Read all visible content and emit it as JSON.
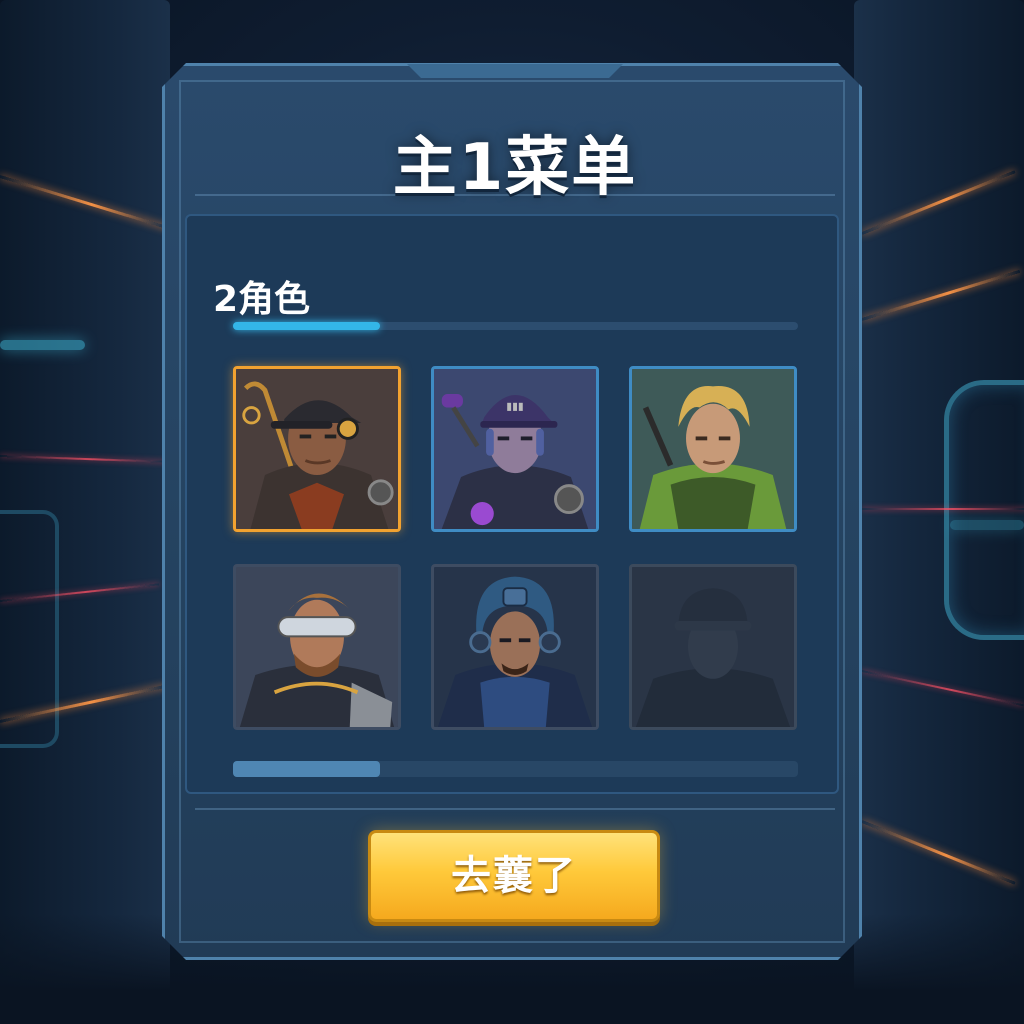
{
  "panel": {
    "title": "主1菜单",
    "section_title": "2角色",
    "section_progress": 0.26,
    "scroll_position": 0.26,
    "confirm_label": "去蘘了"
  },
  "characters": [
    {
      "id": "char-1",
      "state": "selected",
      "portrait": "mechanic-cap-headset"
    },
    {
      "id": "char-2",
      "state": "available",
      "portrait": "purple-cap-cyborg"
    },
    {
      "id": "char-3",
      "state": "available",
      "portrait": "blond-green-armor"
    },
    {
      "id": "char-4",
      "state": "available",
      "portrait": "goggles-bearded"
    },
    {
      "id": "char-5",
      "state": "available",
      "portrait": "blue-helmet-soldier"
    },
    {
      "id": "char-6",
      "state": "locked",
      "portrait": "shadow-helmet"
    }
  ],
  "colors": {
    "accent_blue": "#33b6e8",
    "selected_orange": "#f2a230",
    "button_yellow": "#ffc93a"
  }
}
